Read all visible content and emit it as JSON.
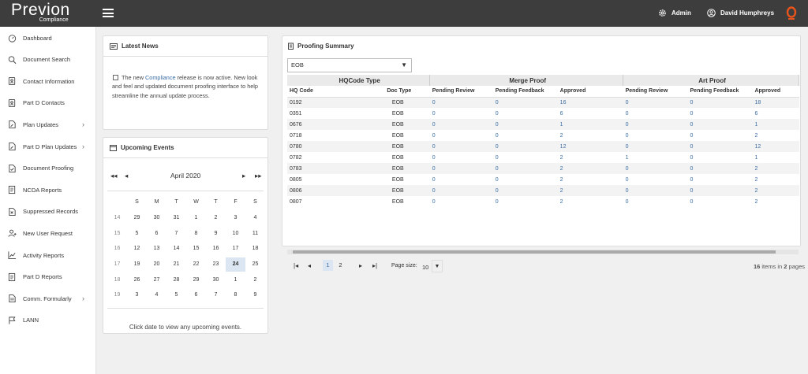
{
  "header": {
    "logo_main": "Previon",
    "logo_sub": "Compliance",
    "admin_label": "Admin",
    "user_name": "David Humphreys"
  },
  "sidebar": {
    "items": [
      {
        "label": "Dashboard",
        "icon": "dashboard-icon",
        "has_chevron": false
      },
      {
        "label": "Document Search",
        "icon": "search-icon",
        "has_chevron": false
      },
      {
        "label": "Contact Information",
        "icon": "contact-icon",
        "has_chevron": false
      },
      {
        "label": "Part D Contacts",
        "icon": "contact-icon",
        "has_chevron": false
      },
      {
        "label": "Plan Updates",
        "icon": "document-edit-icon",
        "has_chevron": true
      },
      {
        "label": "Part D Plan Updates",
        "icon": "document-edit-icon",
        "has_chevron": true
      },
      {
        "label": "Document Proofing",
        "icon": "document-check-icon",
        "has_chevron": false
      },
      {
        "label": "NCDA Reports",
        "icon": "report-icon",
        "has_chevron": false
      },
      {
        "label": "Suppressed Records",
        "icon": "document-x-icon",
        "has_chevron": false
      },
      {
        "label": "New User Request",
        "icon": "add-user-icon",
        "has_chevron": false
      },
      {
        "label": "Activity Reports",
        "icon": "chart-icon",
        "has_chevron": false
      },
      {
        "label": "Part D Reports",
        "icon": "report-icon",
        "has_chevron": false
      },
      {
        "label": "Comm. Formularly",
        "icon": "document-icon",
        "has_chevron": true
      },
      {
        "label": "LANN",
        "icon": "flag-icon",
        "has_chevron": false
      }
    ]
  },
  "news": {
    "title": "Latest News",
    "text_pre": "The new ",
    "text_highlight": "Compliance",
    "text_post": " release is now active. New look and feel and updated document proofing interface to help streamline the annual update process."
  },
  "events": {
    "title": "Upcoming Events",
    "month": "April 2020",
    "weekdays": [
      "S",
      "M",
      "T",
      "W",
      "T",
      "F",
      "S"
    ],
    "weeks": [
      {
        "wk": "14",
        "days": [
          "29",
          "30",
          "31",
          "1",
          "2",
          "3",
          "4"
        ]
      },
      {
        "wk": "15",
        "days": [
          "5",
          "6",
          "7",
          "8",
          "9",
          "10",
          "11"
        ]
      },
      {
        "wk": "16",
        "days": [
          "12",
          "13",
          "14",
          "15",
          "16",
          "17",
          "18"
        ]
      },
      {
        "wk": "17",
        "days": [
          "19",
          "20",
          "21",
          "22",
          "23",
          "24",
          "25"
        ]
      },
      {
        "wk": "18",
        "days": [
          "26",
          "27",
          "28",
          "29",
          "30",
          "1",
          "2"
        ]
      },
      {
        "wk": "19",
        "days": [
          "3",
          "4",
          "5",
          "6",
          "7",
          "8",
          "9"
        ]
      }
    ],
    "selected_day": "24",
    "message": "Click date to view any upcoming events."
  },
  "proofing": {
    "title": "Proofing Summary",
    "filter_value": "EOB",
    "group_headers": [
      "HQCode Type",
      "Merge Proof",
      "Art Proof"
    ],
    "columns": [
      "HQ Code",
      "Doc Type",
      "Pending Review",
      "Pending Feedback",
      "Approved",
      "Pending Review",
      "Pending Feedback",
      "Approved"
    ],
    "rows": [
      [
        "0192",
        "EOB",
        "0",
        "0",
        "16",
        "0",
        "0",
        "18"
      ],
      [
        "0351",
        "EOB",
        "0",
        "0",
        "6",
        "0",
        "0",
        "6"
      ],
      [
        "0676",
        "EOB",
        "0",
        "0",
        "1",
        "0",
        "0",
        "1"
      ],
      [
        "0718",
        "EOB",
        "0",
        "0",
        "2",
        "0",
        "0",
        "2"
      ],
      [
        "0780",
        "EOB",
        "0",
        "0",
        "12",
        "0",
        "0",
        "12"
      ],
      [
        "0782",
        "EOB",
        "0",
        "0",
        "2",
        "1",
        "0",
        "1"
      ],
      [
        "0783",
        "EOB",
        "0",
        "0",
        "2",
        "0",
        "0",
        "2"
      ],
      [
        "0805",
        "EOB",
        "0",
        "0",
        "2",
        "0",
        "0",
        "2"
      ],
      [
        "0806",
        "EOB",
        "0",
        "0",
        "2",
        "0",
        "0",
        "2"
      ],
      [
        "0807",
        "EOB",
        "0",
        "0",
        "2",
        "0",
        "0",
        "2"
      ]
    ],
    "pages": [
      "1",
      "2"
    ],
    "current_page": "1",
    "page_size_label": "Page size:",
    "page_size": "10",
    "summary_total": "16",
    "summary_mid": " items in ",
    "summary_pages": "2",
    "summary_end": " pages"
  },
  "colors": {
    "topbar": "#3d3d3d",
    "link": "#3a6ea5",
    "brand_orange": "#e8541c"
  }
}
